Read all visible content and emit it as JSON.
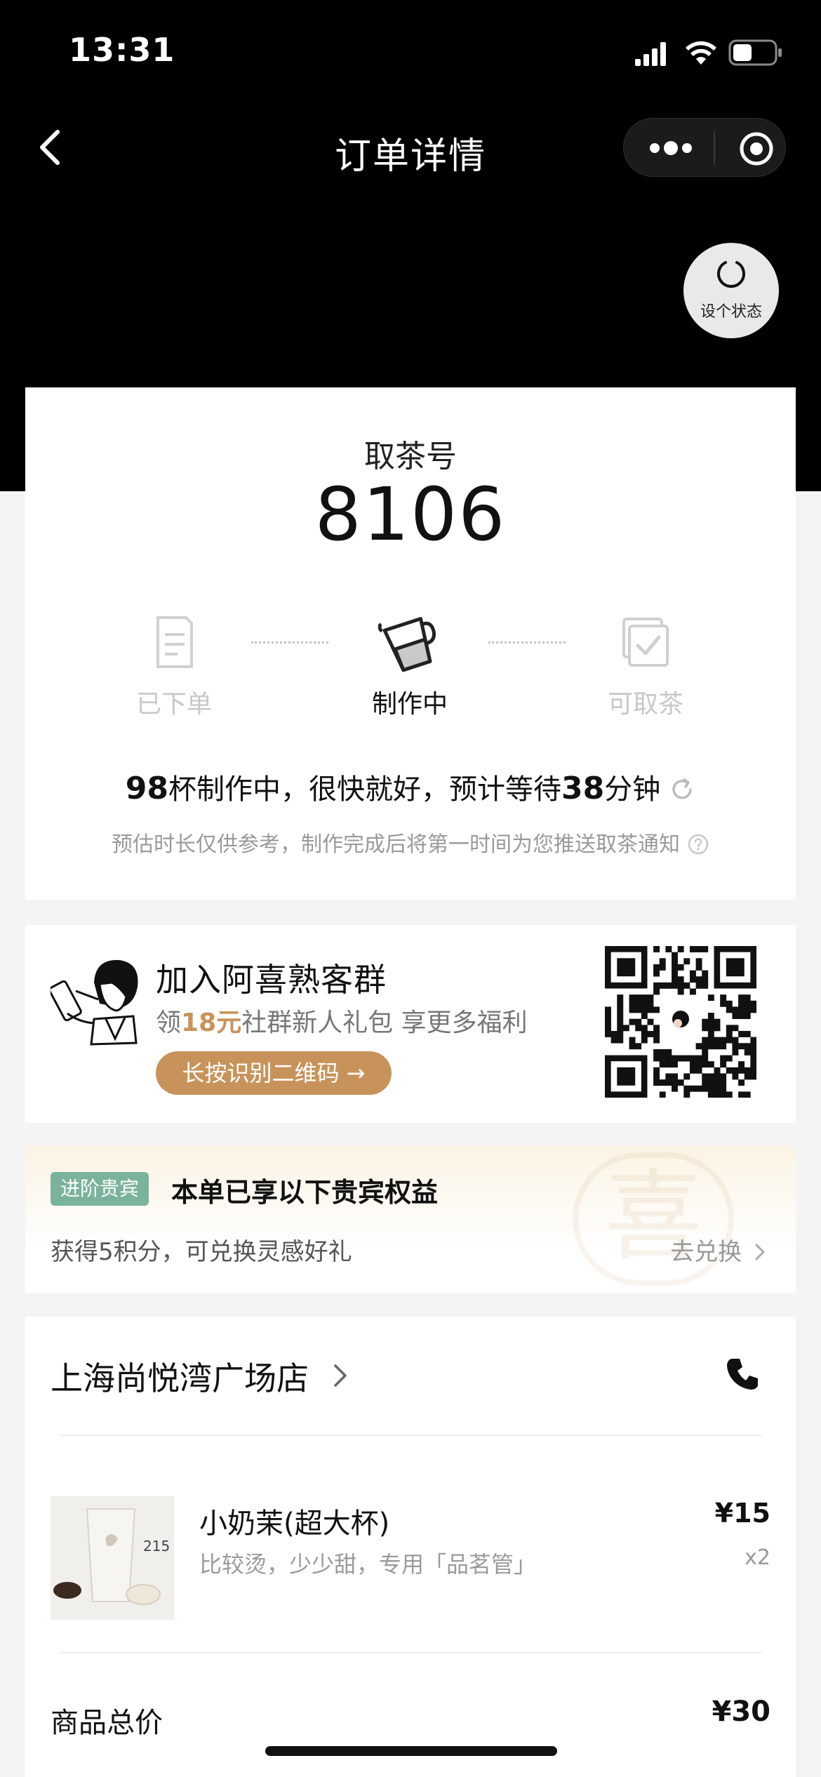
{
  "status_bar": {
    "time": "13:31"
  },
  "nav": {
    "title": "订单详情"
  },
  "status_setter": {
    "label": "设个状态"
  },
  "pickup": {
    "label": "取茶号",
    "number": "8106",
    "steps": [
      {
        "label": "已下单",
        "icon": "receipt-icon",
        "active": false
      },
      {
        "label": "制作中",
        "icon": "shaker-cup-icon",
        "active": true
      },
      {
        "label": "可取茶",
        "icon": "cup-check-icon",
        "active": false
      }
    ],
    "wait": {
      "cups": "98",
      "text_1": "杯制作中，很快就好，预计等待",
      "minutes": "38",
      "text_2": "分钟"
    },
    "note": "预估时长仅供参考，制作完成后将第一时间为您推送取茶通知"
  },
  "group": {
    "title": "加入阿喜熟客群",
    "sub_prefix": "领",
    "sub_amount": "18元",
    "sub_suffix": "社群新人礼包 享更多福利",
    "button": "长按识别二维码 →",
    "accent_color": "#c8935a"
  },
  "vip": {
    "badge": "进阶贵宾",
    "title": "本单已享以下贵宾权益",
    "points": "获得5积分，可兑换灵感好礼",
    "link": "去兑换",
    "watermark": "喜",
    "badge_color": "#7ab39c"
  },
  "order": {
    "store_name": "上海尚悦湾广场店",
    "items": [
      {
        "name": "小奶茉(超大杯)",
        "options": "比较烫，少少甜，专用「品茗管」",
        "price": "¥15",
        "qty": "x2",
        "thumb_text": "215"
      }
    ],
    "total_label": "商品总价",
    "total_value": "¥30"
  }
}
